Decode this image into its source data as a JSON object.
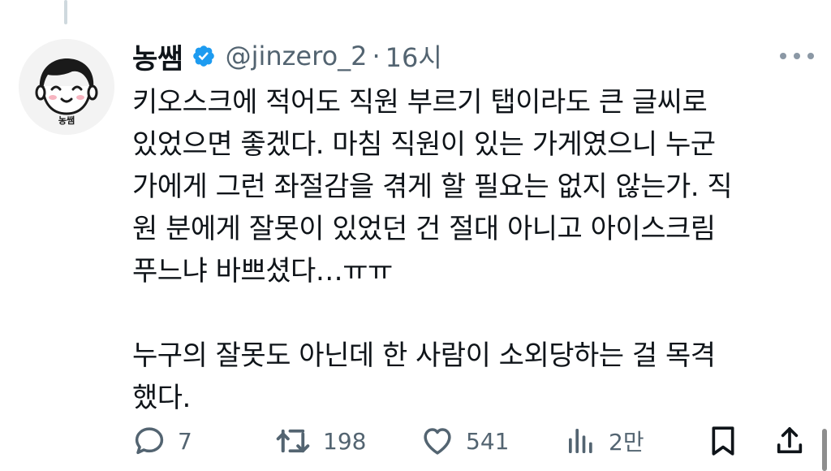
{
  "author": {
    "name": "농쌤",
    "handle": "@jinzero_2",
    "separator": "·",
    "time": "16시",
    "avatar_label": "농쌤"
  },
  "icons": {
    "verified": "verified-badge-icon",
    "more": "more-dots-icon",
    "reply": "reply-icon",
    "retweet": "retweet-icon",
    "like": "heart-icon",
    "views": "views-bars-icon",
    "bookmark": "bookmark-icon",
    "share": "share-icon"
  },
  "colors": {
    "verified": "#1d9bf0",
    "muted": "#536471",
    "text": "#0f1419"
  },
  "body": {
    "line1": "키오스크에 적어도 직원 부르기 탭이라도 큰 글씨로",
    "line2": "있었으면 좋겠다. 마침 직원이 있는 가게였으니 누군",
    "line3": "가에게 그런 좌절감을 겪게 할 필요는 없지 않는가. 직",
    "line4": "원 분에게 잘못이 있었던 건 절대 아니고 아이스크림",
    "line5": "푸느냐 바쁘셨다…ㅠㅠ",
    "line6": "누구의 잘못도 아닌데 한 사람이 소외당하는 걸 목격",
    "line7": "했다."
  },
  "actions": {
    "replies": "7",
    "retweets": "198",
    "likes": "541",
    "views": "2만"
  }
}
